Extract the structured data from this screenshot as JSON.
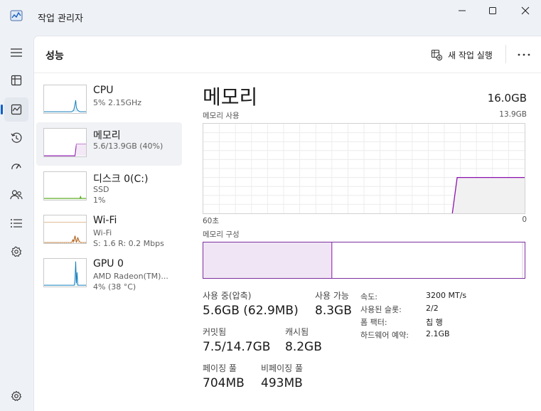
{
  "app": {
    "title": "작업 관리자"
  },
  "header": {
    "title": "성능",
    "new_task_label": "새 작업 실행"
  },
  "rail": {
    "items": [
      {
        "icon": "hamburger-icon"
      },
      {
        "icon": "processes-icon"
      },
      {
        "icon": "performance-icon",
        "active": true
      },
      {
        "icon": "app-history-icon"
      },
      {
        "icon": "startup-apps-icon"
      },
      {
        "icon": "users-icon"
      },
      {
        "icon": "details-icon"
      },
      {
        "icon": "services-icon"
      },
      {
        "icon": "settings-icon"
      }
    ]
  },
  "devices": [
    {
      "name": "CPU",
      "sub1": "5% 2.15GHz",
      "sub2": "",
      "color": "#117dbb"
    },
    {
      "name": "메모리",
      "sub1": "5.6/13.9GB (40%)",
      "sub2": "",
      "color": "#8b12ae",
      "selected": true
    },
    {
      "name": "디스크 0(C:)",
      "sub1": "SSD",
      "sub2": "1%",
      "color": "#4da60c"
    },
    {
      "name": "Wi-Fi",
      "sub1": "Wi-Fi",
      "sub2": "S: 1.6 R: 0.2 Mbps",
      "color": "#a74f01"
    },
    {
      "name": "GPU 0",
      "sub1": "AMD Radeon(TM)...",
      "sub2": "4% (38 °C)",
      "color": "#117dbb"
    }
  ],
  "detail": {
    "title": "메모리",
    "total": "16.0GB",
    "usage_label": "메모리 사용",
    "usage_max": "13.9GB",
    "axis_left": "60초",
    "axis_right": "0",
    "composition_label": "메모리 구성",
    "in_use_fraction": 0.4,
    "accent": "#8b12ae",
    "fill": "#f1f1f1",
    "comp_fill": "#f0e5f4"
  },
  "stats": {
    "in_use_label": "사용 중(압축)",
    "in_use_value": "5.6GB (62.9MB)",
    "available_label": "사용 가능",
    "available_value": "8.3GB",
    "committed_label": "커밋됨",
    "committed_value": "7.5/14.7GB",
    "cached_label": "캐시됨",
    "cached_value": "8.2GB",
    "paged_label": "페이징 풀",
    "paged_value": "704MB",
    "nonpaged_label": "비페이징 풀",
    "nonpaged_value": "493MB"
  },
  "specs": [
    {
      "label": "속도:",
      "value": "3200 MT/s"
    },
    {
      "label": "사용된 슬롯:",
      "value": "2/2"
    },
    {
      "label": "폼 팩터:",
      "value": "칩 행"
    },
    {
      "label": "하드웨어 예약:",
      "value": "2.1GB"
    }
  ]
}
